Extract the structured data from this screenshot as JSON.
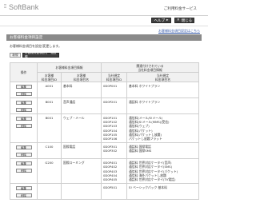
{
  "header": {
    "logo_text": "SoftBank",
    "site_title": "ご利用料金サービス",
    "help_label": "ヘルプ",
    "close_label": "閉じる",
    "top_link": "お客様料金項目設定はこちら"
  },
  "section": {
    "title": "お客様料金項目設定",
    "description": "お客様料金項目を設定/変更します。",
    "btn_new": "新規",
    "btn_register": "お客様料金項目を一括登録"
  },
  "table": {
    "head_op": "操作",
    "head_group1": "お客様料金項目情報",
    "head_group2": "関連付けされている\n当社料金項目情報",
    "sub1a": "お客様\n料金項目ID",
    "sub1b": "お客様\n料金項目名",
    "sub2a": "当社規定\n料金項目ID",
    "sub2b": "当社規定\n料金項目名",
    "btn_edit": "編集",
    "btn_delete": "削除",
    "rows": [
      {
        "id": "A001",
        "name": "基本料",
        "codes": [
          "0D0P001"
        ],
        "names": [
          "基本料 ホワイトプラン"
        ]
      },
      {
        "id": "B001",
        "name": "音声通話",
        "codes": [
          "0D0P201"
        ],
        "names": [
          "通話料 ホワイトプラン"
        ]
      },
      {
        "id": "B001",
        "name": "ウェブ・メール",
        "codes": [
          "0D0P101",
          "0D0P102",
          "0D0P103",
          "0D0P104",
          "0D0P105",
          "0D0P106"
        ],
        "names": [
          "通信料(メール/S!メール)",
          "通信料(S!メール(MMS)/受信)",
          "通信料(ウェブ)",
          "通信料(パケット)",
          "通信料(パケットし放題)",
          "パケットし放題フラット"
        ]
      },
      {
        "id": "C100",
        "name": "国際電話",
        "codes": [
          "0D0P301",
          "0D0P302"
        ],
        "names": [
          "通話料 国際電話",
          "通話料 国際SMS"
        ]
      },
      {
        "id": "G200",
        "name": "国際ローミング",
        "codes": [
          "0D0P401",
          "0D0P402",
          "0D0P403",
          "0D0P404",
          "0D0P405"
        ],
        "names": [
          "通話料 世界対応ケータイ(音声)",
          "通信料 世界対応ケータイ(SMS)",
          "通信料 世界対応ケータイ(パケット)",
          "通信料 海外パケットし放題",
          "通話料 世界対応ケータイ(TV電話)"
        ]
      },
      {
        "id": "",
        "name": "",
        "codes": [
          "0D0P501"
        ],
        "names": [
          "S! ベーシックパック 基本料"
        ]
      }
    ]
  }
}
